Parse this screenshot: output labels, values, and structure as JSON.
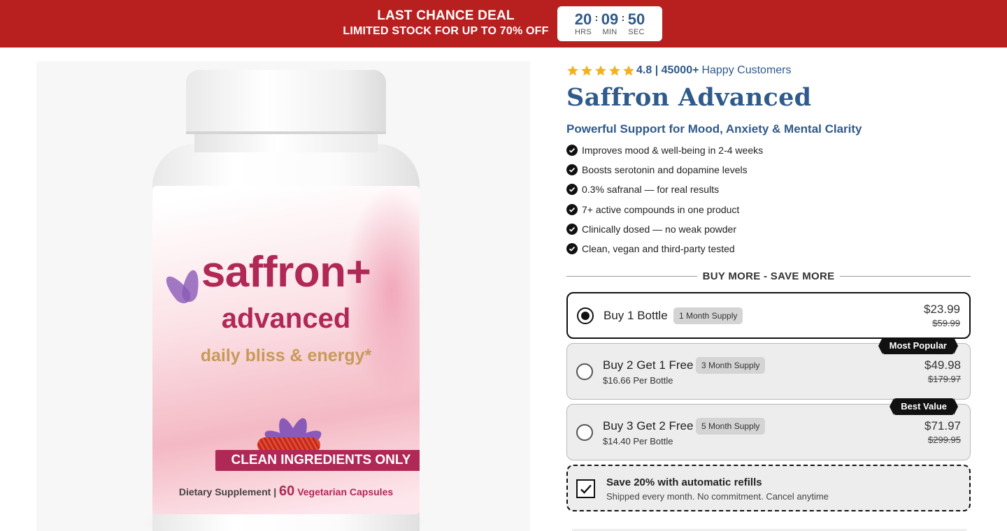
{
  "banner": {
    "title": "LAST CHANCE DEAL",
    "subtitle": "LIMITED STOCK FOR UP TO 70% OFF",
    "countdown": [
      {
        "value": "20",
        "label": "HRS"
      },
      {
        "value": "09",
        "label": "MIN"
      },
      {
        "value": "50",
        "label": "SEC"
      }
    ],
    "separator": ":",
    "background_color": "#b8201f"
  },
  "product_image": {
    "brand": "saffron+",
    "variant": "advanced",
    "tagline": "daily bliss & energy*",
    "claim": "CLEAN INGREDIENTS ONLY",
    "dietary_label": "Dietary Supplement",
    "dietary_divider": "|",
    "capsule_count": "60",
    "capsule_type": "Vegetarian Capsules"
  },
  "rating": {
    "stars": 5,
    "score_and_count": "4.8 | 45000+",
    "label": "Happy Customers"
  },
  "product": {
    "title": "Saffron Advanced",
    "subtitle": "Powerful Support for Mood, Anxiety & Mental Clarity",
    "benefits": [
      "Improves mood & well-being in 2-4 weeks",
      "Boosts serotonin and dopamine levels",
      "0.3% safranal — for real results",
      "7+ active compounds in one product",
      "Clinically dosed — no weak powder",
      "Clean, vegan and third-party tested"
    ]
  },
  "offers": {
    "heading": "BUY MORE - SAVE MORE",
    "items": [
      {
        "name": "Buy 1 Bottle",
        "supply": "1 Month Supply",
        "per_bottle": "",
        "price": "$23.99",
        "old_price": "$59.99",
        "ribbon": "",
        "selected": true
      },
      {
        "name": "Buy 2 Get 1 Free",
        "supply": "3 Month Supply",
        "per_bottle": "$16.66 Per Bottle",
        "price": "$49.98",
        "old_price": "$179.97",
        "ribbon": "Most Popular",
        "selected": false
      },
      {
        "name": "Buy 3 Get 2 Free",
        "supply": "5 Month Supply",
        "per_bottle": "$14.40 Per Bottle",
        "price": "$71.97",
        "old_price": "$299.95",
        "ribbon": "Best Value",
        "selected": false
      }
    ]
  },
  "refill": {
    "title": "Save 20% with automatic refills",
    "subtitle": "Shipped every month. No commitment. Cancel anytime",
    "checked": true
  },
  "colors": {
    "accent_blue": "#2f5a8a",
    "brand_pink": "#b02856",
    "star_gold": "#f3b21a"
  }
}
